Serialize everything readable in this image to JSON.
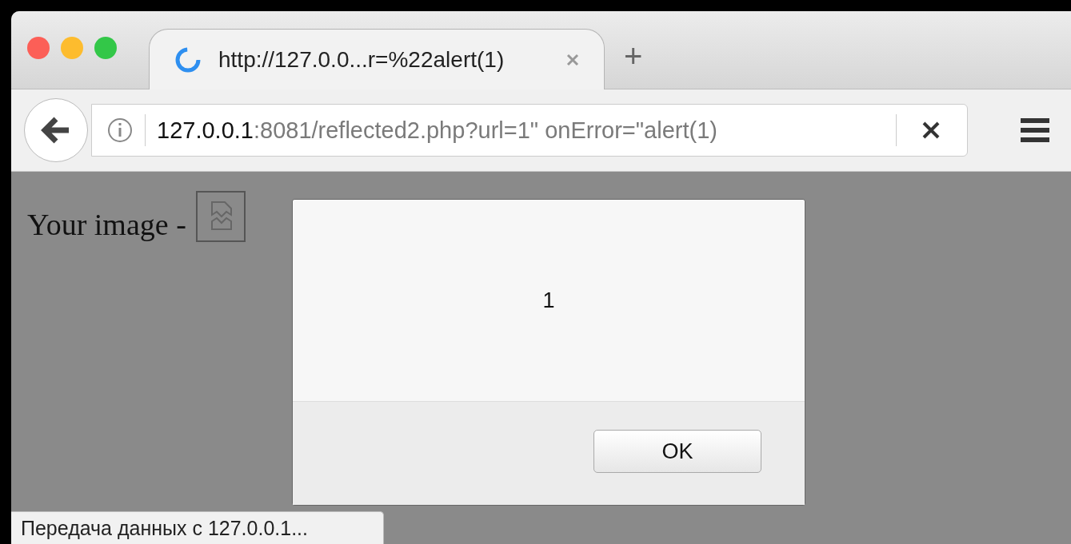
{
  "tabs": [
    {
      "title": "http://127.0.0...r=%22alert(1)",
      "selected": true,
      "loading": true
    }
  ],
  "new_tab_label": "+",
  "address_bar": {
    "host": "127.0.0.1",
    "rest": ":8081/reflected2.php?url=1\" onError=\"alert(1)"
  },
  "page": {
    "text": "Your image -",
    "image_broken": true
  },
  "alert": {
    "message": "1",
    "buttons": [
      "OK"
    ]
  },
  "status_bar": "Передача данных с 127.0.0.1..."
}
